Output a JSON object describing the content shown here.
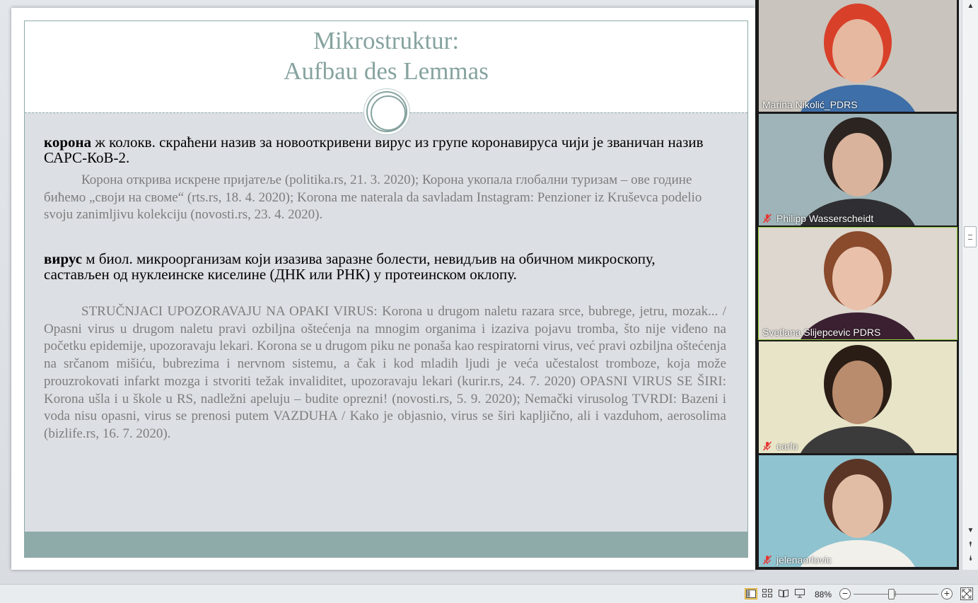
{
  "slide": {
    "title_line1": "Mikrostruktur:",
    "title_line2": "Aufbau des Lemmas",
    "entries": [
      {
        "lemma": "корона",
        "definition": " ж колокв. скраћени назив за новооткривени вирус из групе коронавируса чији је званичан назив САРС-КоВ-2.",
        "citations": "Корона открива искрене пријатеље (politika.rs, 21. 3. 2020); Корона укопала глобални туризам – ове године бићемо „своји на своме“ (rts.rs, 18. 4. 2020); Korona me naterala da savladam Instagram: Penzioner iz Kruševca podelio svoju zanimljivu kolekciju (novosti.rs, 23. 4. 2020)."
      },
      {
        "lemma": "вирус",
        "definition": " м биол. микроорганизам који изазива заразне болести, невидљив на обичном микроскопу, састављен од нуклеинске киселине (ДНК или РНК) у протеинском оклопу.",
        "citations": "STRUČNJACI UPOZORAVAJU NA OPAKI VIRUS: Korona u drugom naletu razara srce, bubrege, jetru, mozak... / Opasni virus u drugom naletu pravi ozbiljna oštećenja na mnogim organima i izaziva pojavu tromba, što nije viđeno na početku epidemije, upozoravaju lekari. Korona se u drugom piku ne ponaša kao respiratorni virus, već pravi ozbiljna oštećenja na srčanom mišiću, bubrezima i nervnom sistemu, a čak i kod mladih ljudi je veća učestalost tromboze, koja može prouzrokovati infarkt mozga i stvoriti težak invaliditet, upozoravaju lekari (kurir.rs, 24. 7. 2020) OPASNI VIRUS SE ŠIRI: Korona ušla i u škole u RS, nadležni apeluju – budite oprezni! (novosti.rs, 5. 9. 2020); Nemački virusolog TVRDI: Bazeni i voda nisu opasni, virus se prenosi putem VAZDUHA / Kako je objasnio, virus se širi kapljično, ali i vazduhom, aerosolima (bizlife.rs, 16. 7. 2020)."
      }
    ]
  },
  "participants": [
    {
      "name": "Marina Nikolić_PDRS",
      "muted": false,
      "active": false,
      "bg": "#c9c4bd",
      "skin": "#e6b8a0",
      "hair": "#d8402a",
      "shirt": "#3e6fa8"
    },
    {
      "name": "Philipp Wasserscheidt",
      "muted": true,
      "active": false,
      "bg": "#9fb4b8",
      "skin": "#d9b39c",
      "hair": "#2b2420",
      "shirt": "#2f2f33"
    },
    {
      "name": "Svetlana Slijepcevic PDRS",
      "muted": false,
      "active": true,
      "bg": "#ddd7cf",
      "skin": "#e9c1ab",
      "hair": "#8a4a2c",
      "shirt": "#3a2030"
    },
    {
      "name": "carlo",
      "muted": true,
      "active": false,
      "bg": "#e8e4c8",
      "skin": "#b98c6e",
      "hair": "#2a1d15",
      "shirt": "#3b3b3b"
    },
    {
      "name": "jelenaorlovic",
      "muted": true,
      "active": false,
      "bg": "#8fc3d0",
      "skin": "#e2bda6",
      "hair": "#5a3526",
      "shirt": "#f2f0ea"
    }
  ],
  "status": {
    "zoom": "88%",
    "zoom_minus": "−",
    "zoom_plus": "+",
    "zoom_fraction": 0.44
  }
}
